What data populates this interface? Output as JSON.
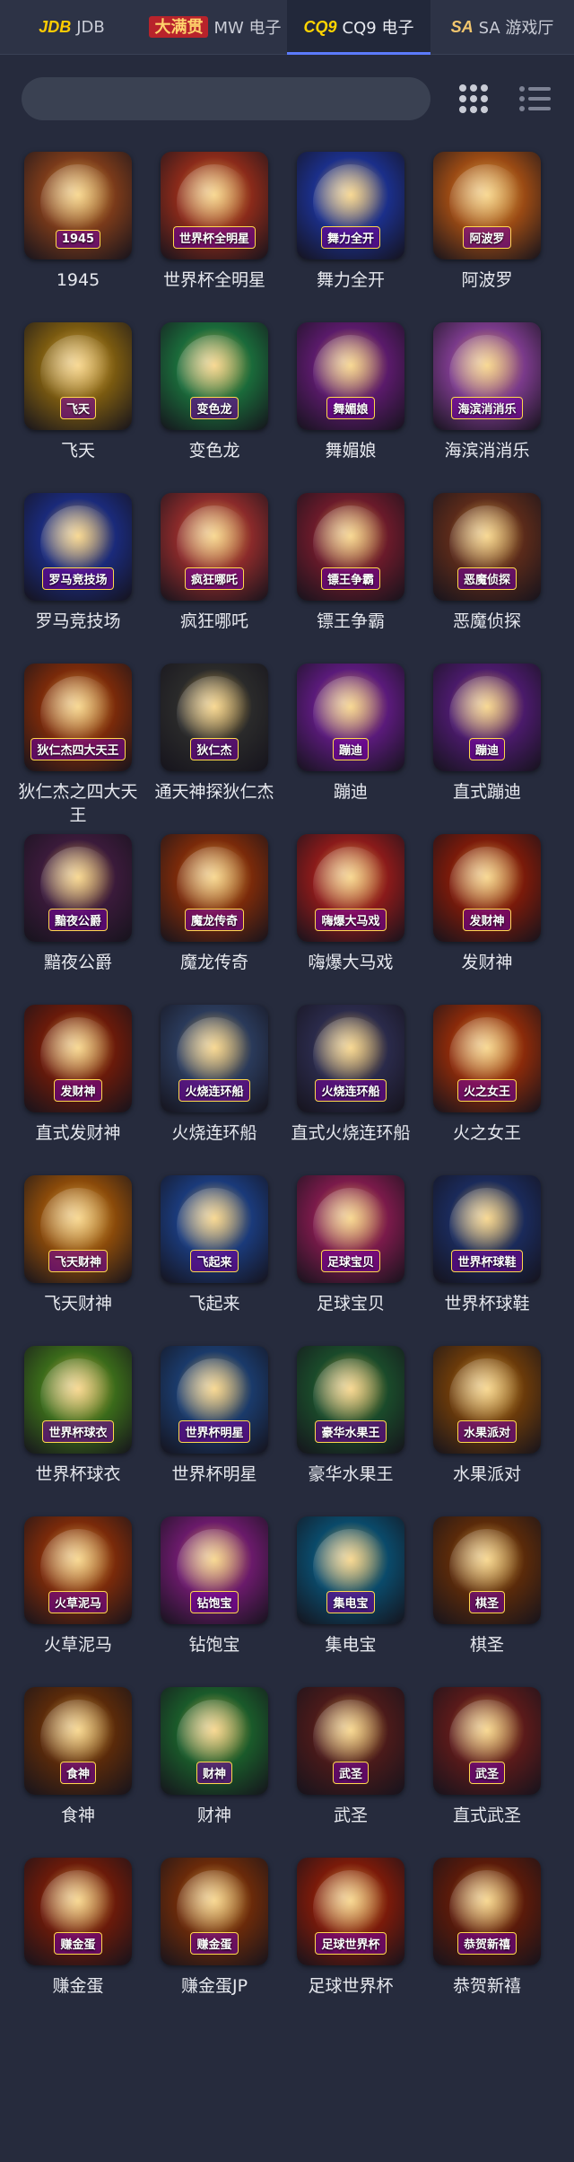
{
  "tabs": [
    {
      "logo": "JDB",
      "label": "JDB",
      "logo_class": "logo-jdb"
    },
    {
      "logo": "大满贯",
      "label": "MW 电子",
      "logo_class": "logo-mw"
    },
    {
      "logo": "CQ9",
      "label": "CQ9 电子",
      "logo_class": "logo-cq9",
      "active": true
    },
    {
      "logo": "SA",
      "label": "SA 游戏厅",
      "logo_class": "logo-sa"
    }
  ],
  "search": {
    "placeholder": ""
  },
  "games": [
    {
      "name": "1945",
      "logo": "1945",
      "bg": "#7a3a1a"
    },
    {
      "name": "世界杯全明星",
      "logo": "世界杯全明星",
      "bg": "#8a2a1a"
    },
    {
      "name": "舞力全开",
      "logo": "舞力全开",
      "bg": "#1b2f8a"
    },
    {
      "name": "阿波罗",
      "logo": "阿波罗",
      "bg": "#9a4a14"
    },
    {
      "name": "飞天",
      "logo": "飞天",
      "bg": "#7a5a10"
    },
    {
      "name": "变色龙",
      "logo": "变色龙",
      "bg": "#1a6a3a"
    },
    {
      "name": "舞媚娘",
      "logo": "舞媚娘",
      "bg": "#5a1a6a"
    },
    {
      "name": "海滨消消乐",
      "logo": "海滨消消乐",
      "bg": "#7a3a8a"
    },
    {
      "name": "罗马竞技场",
      "logo": "罗马竞技场",
      "bg": "#1a2a7a"
    },
    {
      "name": "疯狂哪吒",
      "logo": "疯狂哪吒",
      "bg": "#8a2a2a"
    },
    {
      "name": "镖王争霸",
      "logo": "镖王争霸",
      "bg": "#6a1a2a"
    },
    {
      "name": "恶魔侦探",
      "logo": "恶魔侦探",
      "bg": "#5a2a1a"
    },
    {
      "name": "狄仁杰之四大天王",
      "logo": "狄仁杰四大天王",
      "bg": "#7a2a0a"
    },
    {
      "name": "通天神探狄仁杰",
      "logo": "狄仁杰",
      "bg": "#2a2a2a"
    },
    {
      "name": "蹦迪",
      "logo": "蹦迪",
      "bg": "#5a1a7a"
    },
    {
      "name": "直式蹦迪",
      "logo": "蹦迪",
      "bg": "#4a1a6a"
    },
    {
      "name": "黯夜公爵",
      "logo": "黯夜公爵",
      "bg": "#3a1a3a"
    },
    {
      "name": "魔龙传奇",
      "logo": "魔龙传奇",
      "bg": "#7a2a0a"
    },
    {
      "name": "嗨爆大马戏",
      "logo": "嗨爆大马戏",
      "bg": "#8a1a1a"
    },
    {
      "name": "发财神",
      "logo": "发财神",
      "bg": "#7a1a0a"
    },
    {
      "name": "直式发财神",
      "logo": "发财神",
      "bg": "#6a1a0a"
    },
    {
      "name": "火烧连环船",
      "logo": "火烧连环船",
      "bg": "#2a3a5a"
    },
    {
      "name": "直式火烧连环船",
      "logo": "火烧连环船",
      "bg": "#2a2a4a"
    },
    {
      "name": "火之女王",
      "logo": "火之女王",
      "bg": "#8a2a0a"
    },
    {
      "name": "飞天财神",
      "logo": "飞天财神",
      "bg": "#8a4a0a"
    },
    {
      "name": "飞起来",
      "logo": "飞起来",
      "bg": "#1a3a7a"
    },
    {
      "name": "足球宝贝",
      "logo": "足球宝贝",
      "bg": "#7a1a4a"
    },
    {
      "name": "世界杯球鞋",
      "logo": "世界杯球鞋",
      "bg": "#1a2a5a"
    },
    {
      "name": "世界杯球衣",
      "logo": "世界杯球衣",
      "bg": "#3a6a1a"
    },
    {
      "name": "世界杯明星",
      "logo": "世界杯明星",
      "bg": "#1a3a6a"
    },
    {
      "name": "豪华水果王",
      "logo": "豪华水果王",
      "bg": "#1a4a2a"
    },
    {
      "name": "水果派对",
      "logo": "水果派对",
      "bg": "#6a3a0a"
    },
    {
      "name": "火草泥马",
      "logo": "火草泥马",
      "bg": "#7a2a0a"
    },
    {
      "name": "钻饱宝",
      "logo": "钻饱宝",
      "bg": "#6a1a6a"
    },
    {
      "name": "集电宝",
      "logo": "集电宝",
      "bg": "#0a4a6a"
    },
    {
      "name": "棋圣",
      "logo": "棋圣",
      "bg": "#5a2a0a"
    },
    {
      "name": "食神",
      "logo": "食神",
      "bg": "#5a2a0a"
    },
    {
      "name": "财神",
      "logo": "财神",
      "bg": "#1a5a2a"
    },
    {
      "name": "武圣",
      "logo": "武圣",
      "bg": "#4a1a1a"
    },
    {
      "name": "直式武圣",
      "logo": "武圣",
      "bg": "#5a1a1a"
    },
    {
      "name": "赚金蛋",
      "logo": "赚金蛋",
      "bg": "#6a1a0a"
    },
    {
      "name": "赚金蛋JP",
      "logo": "赚金蛋",
      "bg": "#6a2a0a"
    },
    {
      "name": "足球世界杯",
      "logo": "足球世界杯",
      "bg": "#7a1a0a"
    },
    {
      "name": "恭贺新禧",
      "logo": "恭贺新禧",
      "bg": "#5a1a0a"
    }
  ]
}
